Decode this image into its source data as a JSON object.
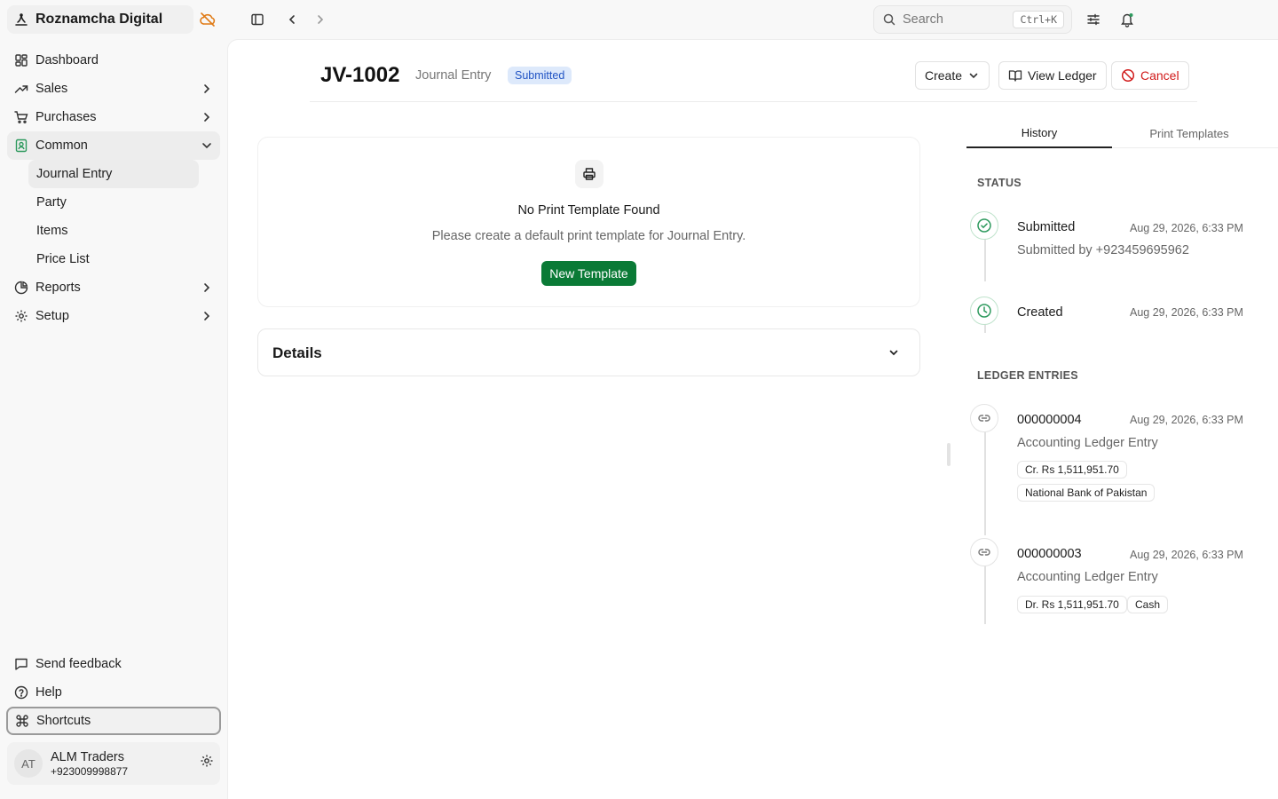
{
  "sidebar": {
    "brand": "Roznamcha Digital",
    "nav": [
      {
        "label": "Dashboard"
      },
      {
        "label": "Sales"
      },
      {
        "label": "Purchases"
      },
      {
        "label": "Common"
      },
      {
        "label": "Reports"
      },
      {
        "label": "Setup"
      }
    ],
    "common_sub": [
      "Journal Entry",
      "Party",
      "Items",
      "Price List"
    ],
    "bottom": [
      "Send feedback",
      "Help",
      "Shortcuts"
    ],
    "user": {
      "initials": "AT",
      "name": "ALM Traders",
      "phone": "+923009998877"
    }
  },
  "topbar": {
    "search_placeholder": "Search",
    "search_shortcut": "Ctrl+K"
  },
  "doc": {
    "title": "JV-1002",
    "type": "Journal Entry",
    "status": "Submitted",
    "actions": {
      "create": "Create",
      "view_ledger": "View Ledger",
      "cancel": "Cancel"
    }
  },
  "print": {
    "title": "No Print Template Found",
    "subtitle": "Please create a default print template for Journal Entry.",
    "button": "New Template"
  },
  "details": {
    "title": "Details"
  },
  "right_panel": {
    "tabs": [
      "History",
      "Print Templates"
    ],
    "status_title": "STATUS",
    "status_events": [
      {
        "title": "Submitted",
        "date": "Aug 29, 2026, 6:33 PM",
        "sub": "Submitted by +923459695962"
      },
      {
        "title": "Created",
        "date": "Aug 29, 2026, 6:33 PM"
      }
    ],
    "ledger_title": "LEDGER ENTRIES",
    "ledger_entries": [
      {
        "id": "000000004",
        "date": "Aug 29, 2026, 6:33 PM",
        "type": "Accounting Ledger Entry",
        "amount": "Cr. Rs 1,511,951.70",
        "account": "National Bank of Pakistan"
      },
      {
        "id": "000000003",
        "date": "Aug 29, 2026, 6:33 PM",
        "type": "Accounting Ledger Entry",
        "amount": "Dr. Rs 1,511,951.70",
        "account": "Cash"
      }
    ]
  },
  "colors": {
    "accent_green": "#0a7a36",
    "status_green": "#2e9a5e",
    "cancel_red": "#d11a1a",
    "badge_blue": "#2154c4"
  }
}
